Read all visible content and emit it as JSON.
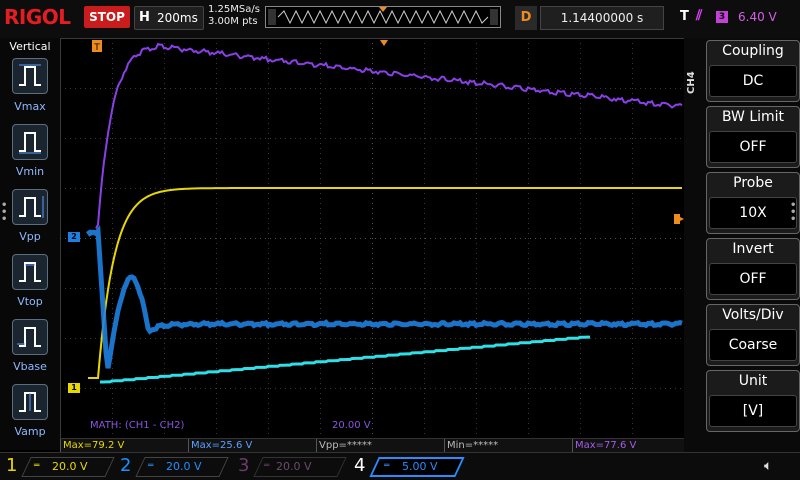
{
  "topbar": {
    "brand": "RIGOL",
    "run_state": "STOP",
    "timebase_label": "H",
    "timebase_value": "200ms",
    "sample_rate": "1.25MSa/s",
    "memory_depth": "3.00M pts",
    "delay_label": "D",
    "delay_value": "1.14400000 s",
    "trigger_label": "T",
    "trigger_source": "3",
    "trigger_level": "6.40 V"
  },
  "left_panel": {
    "title": "Vertical",
    "items": [
      {
        "label": "Vmax",
        "icon": "vmax-icon"
      },
      {
        "label": "Vmin",
        "icon": "vmin-icon"
      },
      {
        "label": "Vpp",
        "icon": "vpp-icon"
      },
      {
        "label": "Vtop",
        "icon": "vtop-icon"
      },
      {
        "label": "Vbase",
        "icon": "vbase-icon"
      },
      {
        "label": "Vamp",
        "icon": "vamp-icon"
      }
    ]
  },
  "grid": {
    "math_label": "MATH: (CH1 - CH2)",
    "math_scale": "20.00 V",
    "markers": {
      "ch1": "1",
      "ch2": "2",
      "trigger": "T"
    }
  },
  "measurements": [
    {
      "text": "Max=79.2 V",
      "color": "#e8d800"
    },
    {
      "text": "Max=25.6 V",
      "color": "#5aa0ff"
    },
    {
      "text": "Vpp=*****",
      "color": "#bbbbbb"
    },
    {
      "text": "Min=*****",
      "color": "#bbbbbb"
    },
    {
      "text": "Max=77.6 V",
      "color": "#a35ee8"
    }
  ],
  "right_panel": {
    "channel": "CH4",
    "menus": [
      {
        "title": "Coupling",
        "value": "DC"
      },
      {
        "title": "BW Limit",
        "value": "OFF"
      },
      {
        "title": "Probe",
        "value": "10X"
      },
      {
        "title": "Invert",
        "value": "OFF"
      },
      {
        "title": "Volts/Div",
        "value": "Coarse"
      },
      {
        "title": "Unit",
        "value": "[V]"
      }
    ]
  },
  "channels": [
    {
      "num": "1",
      "scale": "20.0 V",
      "color": "#e8d800",
      "active": true
    },
    {
      "num": "2",
      "scale": "20.0 V",
      "color": "#1e90ff",
      "active": true
    },
    {
      "num": "3",
      "scale": "20.0 V",
      "color": "#8a3f8a",
      "active": false
    },
    {
      "num": "4",
      "scale": "5.00 V",
      "color": "#2a8cff",
      "active": true
    }
  ],
  "colors": {
    "ch1": "#e8d800",
    "ch2": "#1e7fe0",
    "ch4": "#2ee0e8",
    "math": "#8a3fe8",
    "accent": "#f08c1d"
  }
}
